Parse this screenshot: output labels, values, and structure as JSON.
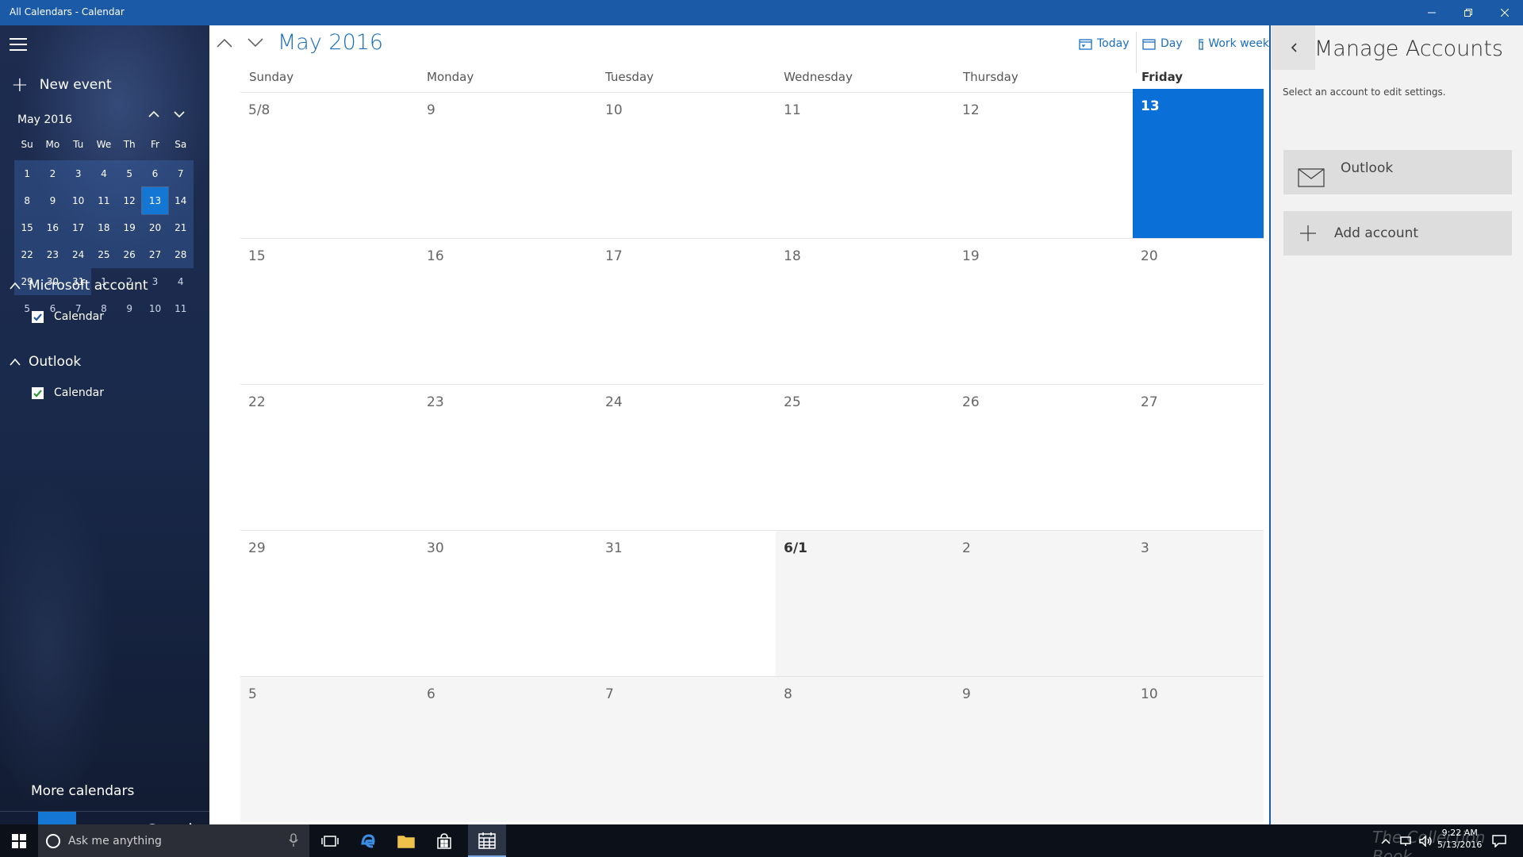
{
  "window": {
    "title": "All Calendars - Calendar"
  },
  "sidebar": {
    "new_event": "New event",
    "mini_calendar": {
      "month_label": "May 2016",
      "weekdays": [
        "Su",
        "Mo",
        "Tu",
        "We",
        "Th",
        "Fr",
        "Sa"
      ],
      "days": [
        "1",
        "2",
        "3",
        "4",
        "5",
        "6",
        "7",
        "8",
        "9",
        "10",
        "11",
        "12",
        "13",
        "14",
        "15",
        "16",
        "17",
        "18",
        "19",
        "20",
        "21",
        "22",
        "23",
        "24",
        "25",
        "26",
        "27",
        "28",
        "29",
        "30",
        "31",
        "1",
        "2",
        "3",
        "4",
        "5",
        "6",
        "7",
        "8",
        "9",
        "10",
        "11"
      ],
      "selected_day": "13"
    },
    "accounts": [
      {
        "name": "Microsoft account",
        "calendar": "Calendar",
        "checked": true
      },
      {
        "name": "Outlook",
        "calendar": "Calendar",
        "checked": true
      }
    ],
    "more_calendars": "More calendars"
  },
  "main": {
    "month_title": "May 2016",
    "views": {
      "today": "Today",
      "day": "Day",
      "work_week": "Work week"
    },
    "weekdays": [
      "Sunday",
      "Monday",
      "Tuesday",
      "Wednesday",
      "Thursday",
      "Friday"
    ],
    "weeks": [
      [
        "5/8",
        "9",
        "10",
        "11",
        "12",
        "13"
      ],
      [
        "15",
        "16",
        "17",
        "18",
        "19",
        "20"
      ],
      [
        "22",
        "23",
        "24",
        "25",
        "26",
        "27"
      ],
      [
        "29",
        "30",
        "31",
        "6/1",
        "2",
        "3"
      ],
      [
        "5",
        "6",
        "7",
        "8",
        "9",
        "10"
      ]
    ],
    "today_label": "13"
  },
  "panel": {
    "title": "Manage Accounts",
    "subtitle": "Select an account to edit settings.",
    "account_label": "Outlook",
    "add_label": "Add account"
  },
  "taskbar": {
    "search_placeholder": "Ask me anything",
    "watermark": "The Collection Book",
    "time": "9:22 AM",
    "date": "5/13/2016"
  },
  "colors": {
    "titlebar": "#1b5aa6",
    "accent": "#1477d3",
    "today_cell": "#0a6fd6",
    "link": "#1a6fbf"
  }
}
